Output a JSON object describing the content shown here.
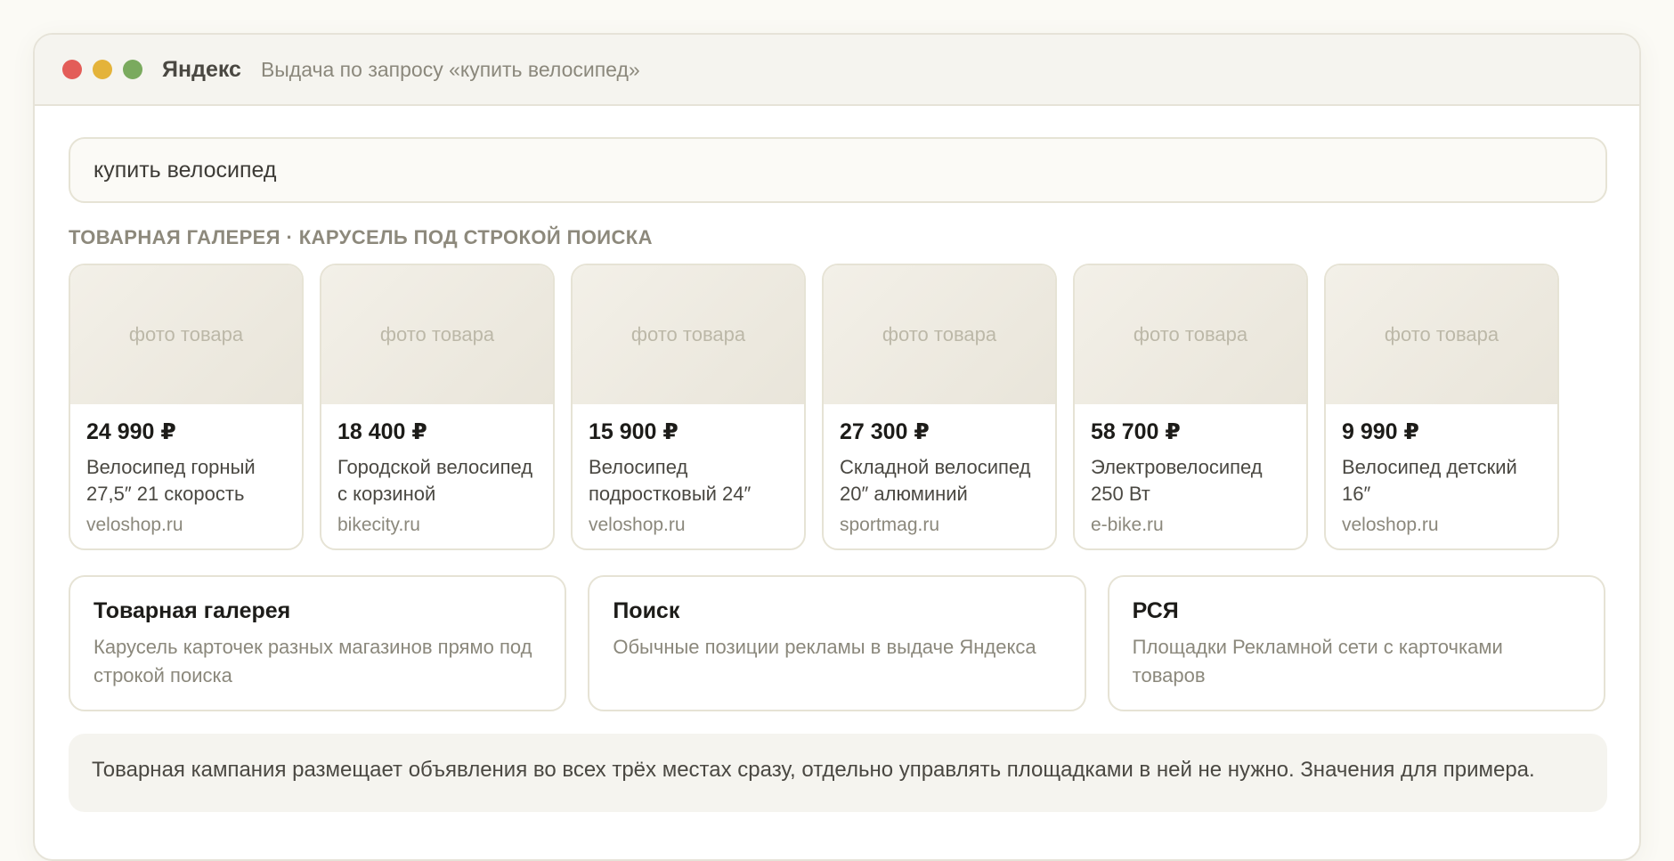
{
  "window": {
    "brand": "Яндекс",
    "title": "Выдача по запросу «купить велосипед»"
  },
  "search": {
    "value": "купить велосипед"
  },
  "gallery": {
    "label": "ТОВАРНАЯ ГАЛЕРЕЯ · КАРУСЕЛЬ ПОД СТРОКОЙ ПОИСКА",
    "photo_placeholder": "фото товара",
    "cards": [
      {
        "price": "24 990 ₽",
        "name": "Велосипед горный 27,5″ 21 скорость",
        "shop": "veloshop.ru"
      },
      {
        "price": "18 400 ₽",
        "name": "Городской велосипед с корзиной",
        "shop": "bikecity.ru"
      },
      {
        "price": "15 900 ₽",
        "name": "Велосипед подростковый 24″",
        "shop": "veloshop.ru"
      },
      {
        "price": "27 300 ₽",
        "name": "Складной велосипед 20″ алюминий",
        "shop": "sportmag.ru"
      },
      {
        "price": "58 700 ₽",
        "name": "Электровелосипед 250 Вт",
        "shop": "e-bike.ru"
      },
      {
        "price": "9 990 ₽",
        "name": "Велосипед детский 16″",
        "shop": "veloshop.ru"
      }
    ]
  },
  "placements": [
    {
      "title": "Товарная галерея",
      "desc": "Карусель карточек разных магазинов прямо под строкой поиска"
    },
    {
      "title": "Поиск",
      "desc": "Обычные позиции рекламы в выдаче Яндекса"
    },
    {
      "title": "РСЯ",
      "desc": "Площадки Рекламной сети с карточками товаров"
    }
  ],
  "note": "Товарная кампания размещает объявления во всех трёх местах сразу, отдельно управлять площадками в ней не нужно. Значения для примера.",
  "colors": {
    "close": "#e35d58",
    "minimize": "#e4b33a",
    "maximize": "#7aaa5e"
  }
}
